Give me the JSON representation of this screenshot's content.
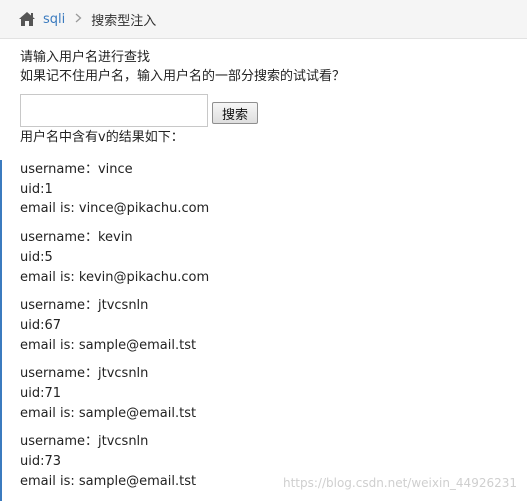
{
  "breadcrumb": {
    "home_icon": "home-icon",
    "link": "sqli",
    "separator": ">",
    "current": "搜索型注入"
  },
  "intro": {
    "line1": "请输入用户名进行查找",
    "line2": "如果记不住用户名，输入用户名的一部分搜索的试试看？"
  },
  "search": {
    "value": "",
    "placeholder": "",
    "button_label": "搜索"
  },
  "result_heading": "用户名中含有v的结果如下：",
  "results": [
    {
      "username": "username：vince",
      "uid": "uid:1",
      "email": "email is: vince@pikachu.com"
    },
    {
      "username": "username：kevin",
      "uid": "uid:5",
      "email": "email is: kevin@pikachu.com"
    },
    {
      "username": "username：jtvcsnln",
      "uid": "uid:67",
      "email": "email is: sample@email.tst"
    },
    {
      "username": "username：jtvcsnln",
      "uid": "uid:71",
      "email": "email is: sample@email.tst"
    },
    {
      "username": "username：jtvcsnln",
      "uid": "uid:73",
      "email": "email is: sample@email.tst"
    }
  ],
  "watermark": "https://blog.csdn.net/weixin_44926231",
  "colors": {
    "link": "#3b7bbf",
    "accent_border": "#3b7bbf",
    "breadcrumb_bg": "#f5f5f5"
  }
}
